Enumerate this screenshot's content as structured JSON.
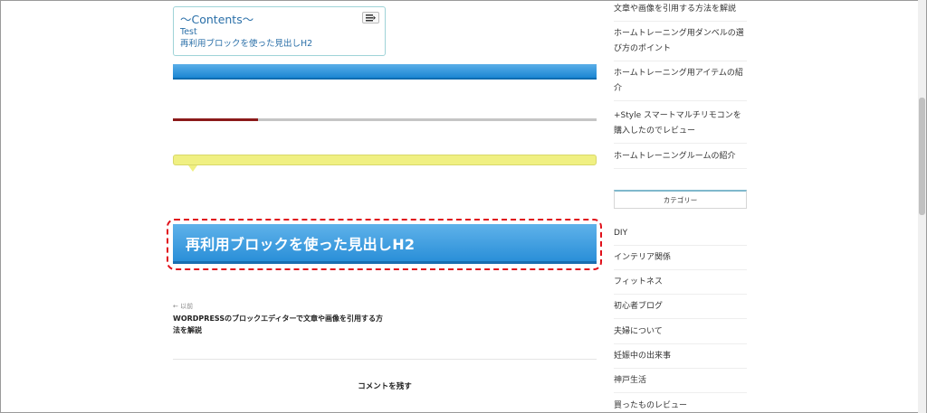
{
  "toc": {
    "title": "～Contents～",
    "items": [
      "Test",
      "再利用ブロックを使った見出しH2"
    ]
  },
  "progress": {
    "fraction": 0.2
  },
  "heading_block": {
    "text": "再利用ブロックを使った見出しH2"
  },
  "post_nav": {
    "prev_label": "← 以前",
    "prev_title": "WORDPRESSのブロックエディターで文章や画像を引用する方法を解説"
  },
  "comments": {
    "heading": "コメントを残す"
  },
  "sidebar": {
    "recent_posts": [
      "文章や画像を引用する方法を解説",
      "ホームトレーニング用ダンベルの選び方のポイント",
      "ホームトレーニング用アイテムの紹介",
      "+Style スマートマルチリモコンを購入したのでレビュー",
      "ホームトレーニングルームの紹介"
    ],
    "category_heading": "カテゴリー",
    "categories": [
      "DIY",
      "インテリア関係",
      "フィットネス",
      "初心者ブログ",
      "夫婦について",
      "妊娠中の出来事",
      "神戸生活",
      "買ったものレビュー"
    ]
  }
}
